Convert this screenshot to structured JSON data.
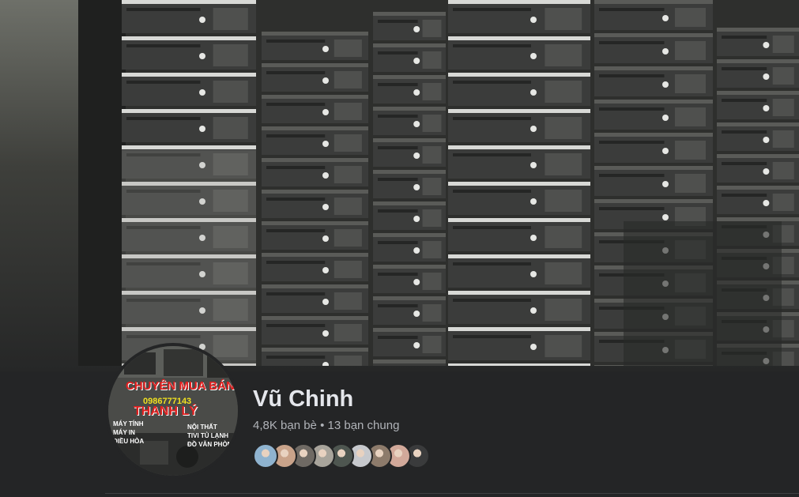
{
  "profile": {
    "name": "Vũ Chinh",
    "friends_count": "4,8K bạn bè",
    "separator": " • ",
    "mutual_friends": "13 bạn chung"
  },
  "profile_picture": {
    "line1": "CHUYÊN MUA BÁN",
    "phone": "0986777143",
    "line2": "THANH LÝ",
    "left_items": [
      "MÁY TÍNH",
      "MÁY IN",
      "ĐIỀU HÒA"
    ],
    "right_items": [
      "NỘI THẤT",
      "TIVI TỦ LẠNH",
      "ĐỒ VĂN PHÒNG"
    ]
  },
  "mutual_friend_avatars": [
    {
      "color": "#8fb3cf"
    },
    {
      "color": "#c9a38a"
    },
    {
      "color": "#6f6a64"
    },
    {
      "color": "#a8a49b"
    },
    {
      "color": "#4e5650"
    },
    {
      "color": "#c7c9cd"
    },
    {
      "color": "#8d7b6b"
    },
    {
      "color": "#d2a99a"
    },
    {
      "color": "#3a3b3c"
    }
  ],
  "cover_photo": {
    "subject": "stacked-desktop-computers"
  }
}
